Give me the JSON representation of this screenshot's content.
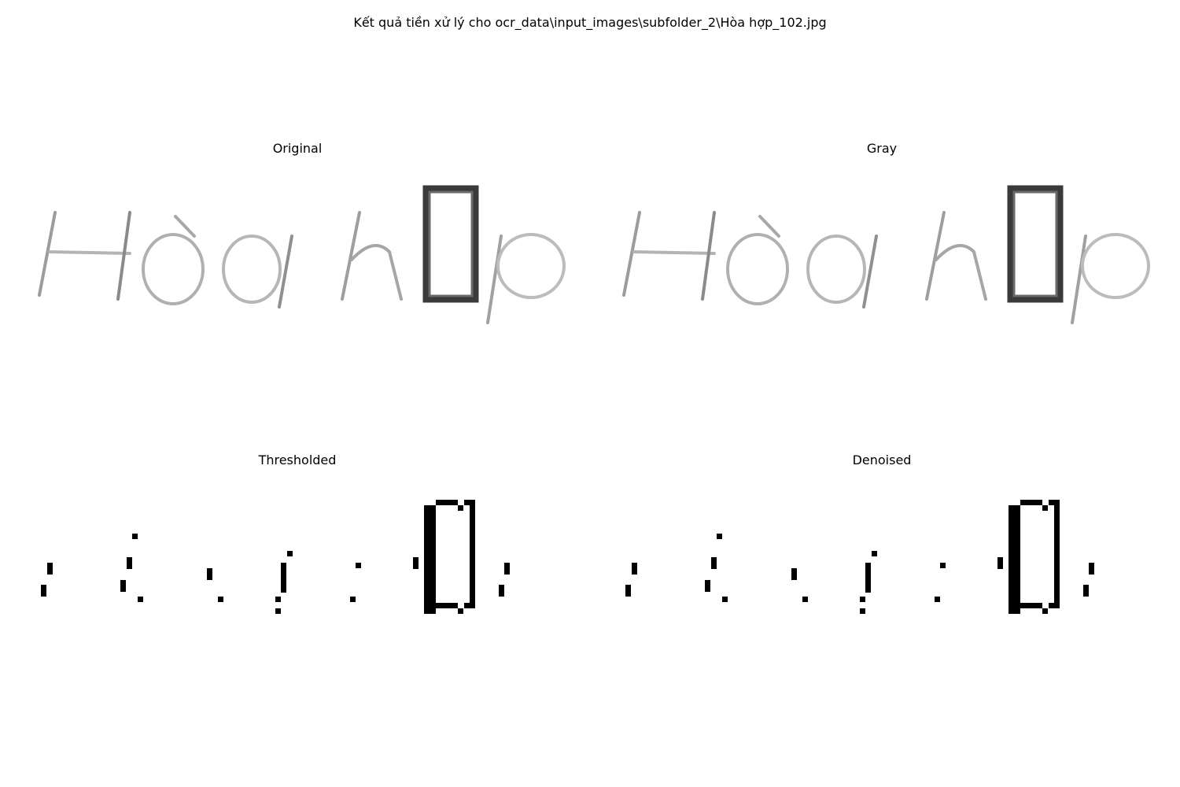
{
  "figure": {
    "title": "Kết quả tiền xử lý cho ocr_data\\input_images\\subfolder_2\\Hòa hợp_102.jpg"
  },
  "panels": [
    {
      "title": "Original",
      "kind": "grayscale-image"
    },
    {
      "title": "Gray",
      "kind": "grayscale-image"
    },
    {
      "title": "Thresholded",
      "kind": "binary-image"
    },
    {
      "title": "Denoised",
      "kind": "binary-image"
    }
  ],
  "colors": {
    "background": "#ffffff",
    "ink_light": "#b8b8b8",
    "ink_mid": "#7a7a7a",
    "ink_dark": "#000000"
  }
}
